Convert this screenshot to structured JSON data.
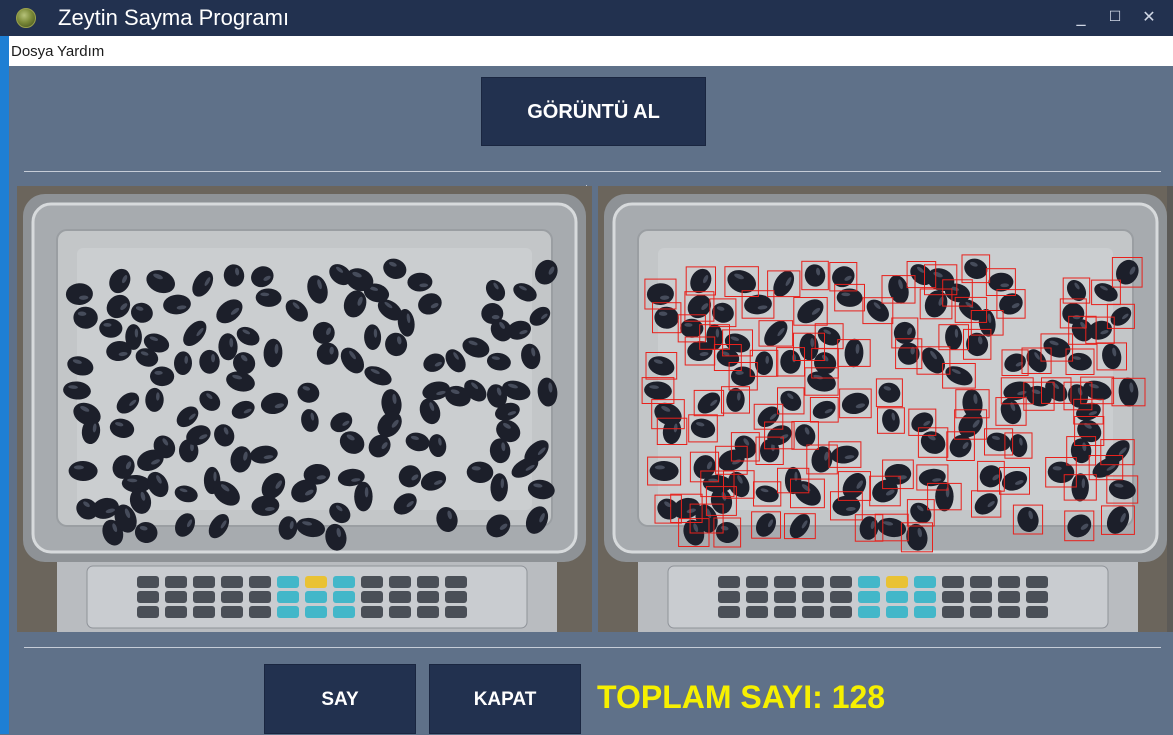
{
  "window": {
    "title": "Zeytin Sayma Programı",
    "controls": {
      "minimize": "_",
      "maximize": "☐",
      "close": "✕"
    }
  },
  "menu": {
    "items": [
      "Dosya",
      "Yardım"
    ]
  },
  "toolbar": {
    "capture_label": "GÖRÜNTÜ AL"
  },
  "actions": {
    "count_label": "SAY",
    "close_label": "KAPAT"
  },
  "result": {
    "label": "TOPLAM SAYI:",
    "value": "128"
  },
  "images": {
    "left": "original-olive-photo",
    "right": "detected-olive-photo"
  },
  "colors": {
    "titlebar": "#22314f",
    "background": "#5f7189",
    "button": "#22314f",
    "total_text": "#f6f000",
    "detection_box": "#e8211c"
  }
}
